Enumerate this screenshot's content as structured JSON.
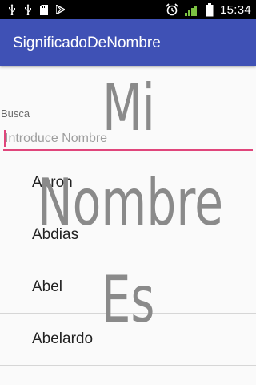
{
  "status_bar": {
    "time": "15:34",
    "left_icons": [
      "usb-icon",
      "usb-icon",
      "sd-card-icon",
      "play-store-icon"
    ],
    "right_icons": [
      "alarm-icon",
      "signal-icon",
      "battery-icon"
    ]
  },
  "app_bar": {
    "title": "SignificadoDeNombre",
    "color": "#3f51b5"
  },
  "search": {
    "label": "Busca",
    "placeholder": "Introduce Nombre",
    "value": "",
    "accent_color": "#e0457b"
  },
  "overlay_text": {
    "line1": "Mi",
    "line2": "Nombre",
    "line3": "Es"
  },
  "names": [
    {
      "label": "Aaron"
    },
    {
      "label": "Abdias"
    },
    {
      "label": "Abel"
    },
    {
      "label": "Abelardo"
    }
  ]
}
